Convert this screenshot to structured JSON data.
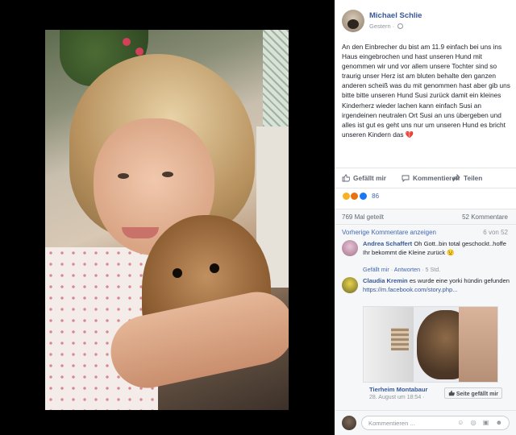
{
  "post": {
    "author": "Michael Schlie",
    "date": "Gestern ·",
    "text": "An den Einbrecher du bist am 11.9 einfach bei uns ins Haus eingebrochen und hast unseren Hund mit genommen wir und vor allem unsere Tochter sind so traurig unser Herz ist am bluten behalte den ganzen anderen scheiß was du mit genommen hast aber gib uns bitte bitte unseren Hund Susi zurück damit ein kleines Kinderherz wieder lachen kann einfach Susi an irgendeinen neutralen Ort Susi an uns übergeben und alles ist gut es geht uns nur um unseren Hund es bricht unseren Kindern das",
    "emoji": "💔"
  },
  "actions": {
    "like": "Gefällt mir",
    "comment": "Kommentieren",
    "share": "Teilen"
  },
  "reactions": {
    "count": "86",
    "colors": [
      "#f7b125",
      "#e9710f",
      "#1877f2"
    ]
  },
  "stats": {
    "shares": "769 Mal geteilt",
    "comments": "52 Kommentare"
  },
  "comments_panel": {
    "previous": "Vorherige Kommentare anzeigen",
    "pager": "6 von 52",
    "items": [
      {
        "name": "Andrea Schaffert",
        "text": "Oh Gott..bin total geschockt..hoffe Ihr bekommt die Kleine zurück 😟",
        "like": "Gefällt mir",
        "reply": "Antworten",
        "time": "5 Std."
      },
      {
        "name": "Claudia Kremin",
        "text": "es wurde eine yorki hündin gefunden",
        "link": "https://m.facebook.com/story.php...",
        "shared_page": "Tierheim Montabaur",
        "shared_date": "28. August um 18:54 ·",
        "shared_button": "Seite gefällt mir"
      }
    ]
  },
  "composer": {
    "placeholder": "Kommentieren ...",
    "tools": "☺ ◎ ▣ ☻"
  }
}
